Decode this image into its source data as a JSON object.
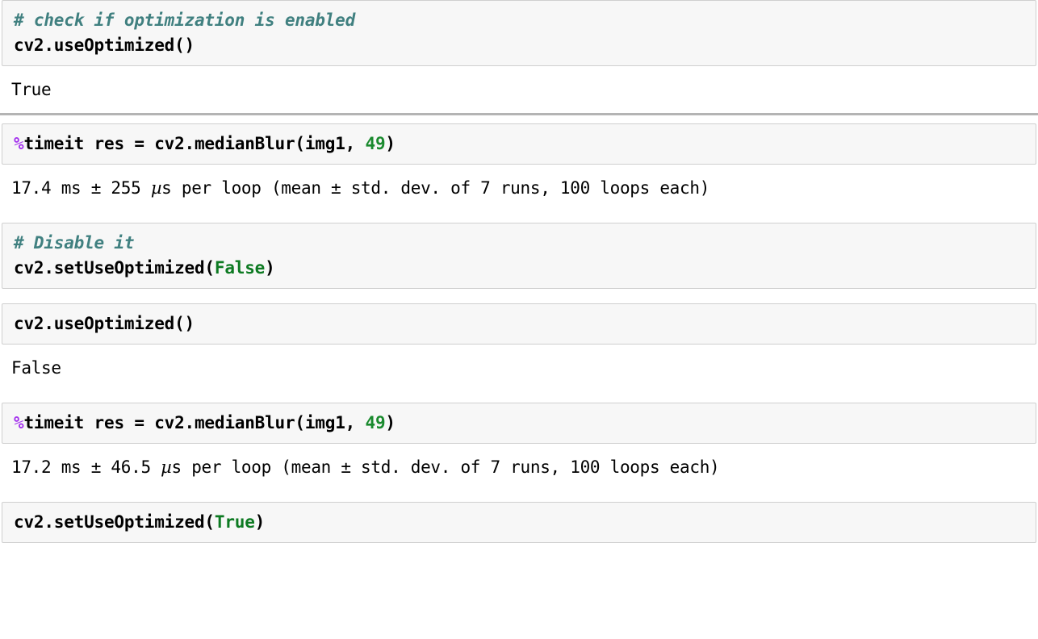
{
  "document": {
    "kind": "jupyter-notebook-fragment",
    "accent_colors": {
      "comment": "#408080",
      "magic": "#a535ee",
      "number": "#1a8a2e",
      "keyword": "#0d7a22",
      "cell_background": "#f7f7f7",
      "cell_border": "#cfcfcf",
      "separator": "#b4b4b4",
      "text": "#000000",
      "page_background": "#ffffff"
    }
  },
  "cells": [
    {
      "id": "cell-1",
      "type": "input",
      "lines": [
        {
          "comment": "# check if optimization is enabled"
        },
        {
          "plain": "cv2.useOptimized()"
        }
      ]
    },
    {
      "id": "cell-1-output",
      "type": "output",
      "lines": [
        "True"
      ]
    },
    {
      "id": "cell-2",
      "type": "input",
      "lines": [
        {
          "magic": "%",
          "plain_before": "timeit res = cv2.medianBlur(img1, ",
          "number": "49",
          "plain_after": ")"
        }
      ]
    },
    {
      "id": "cell-2-output",
      "type": "output",
      "lines": [
        {
          "pre_mu": "17.4 ms ± 255 ",
          "mu": "µ",
          "post_mu": "s per loop (mean ± std. dev. of 7 runs, 100 loops each)"
        }
      ]
    },
    {
      "id": "cell-3",
      "type": "input",
      "lines": [
        {
          "comment": "# Disable it"
        },
        {
          "plain_before": "cv2.setUseOptimized(",
          "keyword": "False",
          "plain_after": ")"
        }
      ]
    },
    {
      "id": "cell-4",
      "type": "input",
      "lines": [
        {
          "plain": "cv2.useOptimized()"
        }
      ]
    },
    {
      "id": "cell-4-output",
      "type": "output",
      "lines": [
        "False"
      ]
    },
    {
      "id": "cell-5",
      "type": "input",
      "lines": [
        {
          "magic": "%",
          "plain_before": "timeit res = cv2.medianBlur(img1, ",
          "number": "49",
          "plain_after": ")"
        }
      ]
    },
    {
      "id": "cell-5-output",
      "type": "output",
      "lines": [
        {
          "pre_mu": "17.2 ms ± 46.5 ",
          "mu": "µ",
          "post_mu": "s per loop (mean ± std. dev. of 7 runs, 100 loops each)"
        }
      ]
    },
    {
      "id": "cell-6",
      "type": "input",
      "lines": [
        {
          "plain_before": "cv2.setUseOptimized(",
          "keyword": "True",
          "plain_after": ")"
        }
      ]
    }
  ],
  "text": {
    "cell1_comment": "# check if optimization is enabled",
    "cell1_code": "cv2.useOptimized()",
    "cell1_result": "True",
    "cell2_magic": "%",
    "cell2_code_before": "timeit res = cv2.medianBlur(img1, ",
    "cell2_number": "49",
    "cell2_code_after": ")",
    "cell2_result_pre": "17.4 ms ± 255 ",
    "cell2_result_mu": "µ",
    "cell2_result_post": "s per loop (mean ± std. dev. of 7 runs, 100 loops each)",
    "cell3_comment": "# Disable it",
    "cell3_code_before": "cv2.setUseOptimized(",
    "cell3_keyword": "False",
    "cell3_code_after": ")",
    "cell4_code": "cv2.useOptimized()",
    "cell4_result": "False",
    "cell5_magic": "%",
    "cell5_code_before": "timeit res = cv2.medianBlur(img1, ",
    "cell5_number": "49",
    "cell5_code_after": ")",
    "cell5_result_pre": "17.2 ms ± 46.5 ",
    "cell5_result_mu": "µ",
    "cell5_result_post": "s per loop (mean ± std. dev. of 7 runs, 100 loops each)",
    "cell6_code_before": "cv2.setUseOptimized(",
    "cell6_keyword": "True",
    "cell6_code_after": ")"
  }
}
